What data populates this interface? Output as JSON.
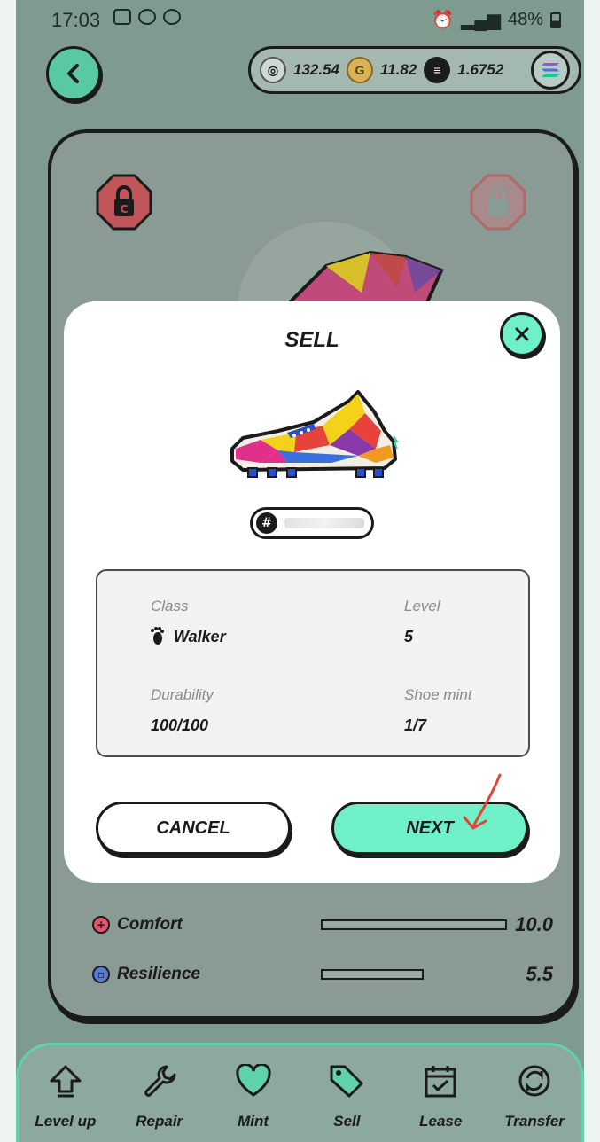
{
  "status_bar": {
    "time": "17:03",
    "battery": "48%"
  },
  "currency": {
    "gst": "132.54",
    "gmt": "11.82",
    "sol": "1.6752"
  },
  "stats": [
    {
      "label": "Comfort",
      "value": "10.0",
      "fill": 1.0,
      "color": "#e0566b"
    },
    {
      "label": "Resilience",
      "value": "5.5",
      "fill": 0.55,
      "color": "#5a7bd6"
    }
  ],
  "modal": {
    "title": "SELL",
    "class_label": "Class",
    "class_value": "Walker",
    "level_label": "Level",
    "level_value": "5",
    "durability_label": "Durability",
    "durability_value": "100/100",
    "shoe_mint_label": "Shoe mint",
    "shoe_mint_value": "1/7",
    "cancel_label": "CANCEL",
    "next_label": "NEXT"
  },
  "nav": [
    {
      "label": "Level up",
      "icon": "level-up-icon"
    },
    {
      "label": "Repair",
      "icon": "wrench-icon"
    },
    {
      "label": "Mint",
      "icon": "heart-icon"
    },
    {
      "label": "Sell",
      "icon": "tag-icon"
    },
    {
      "label": "Lease",
      "icon": "calendar-icon"
    },
    {
      "label": "Transfer",
      "icon": "transfer-icon"
    }
  ],
  "colors": {
    "accent": "#6ff0c8",
    "annotation": "#e0453a"
  }
}
